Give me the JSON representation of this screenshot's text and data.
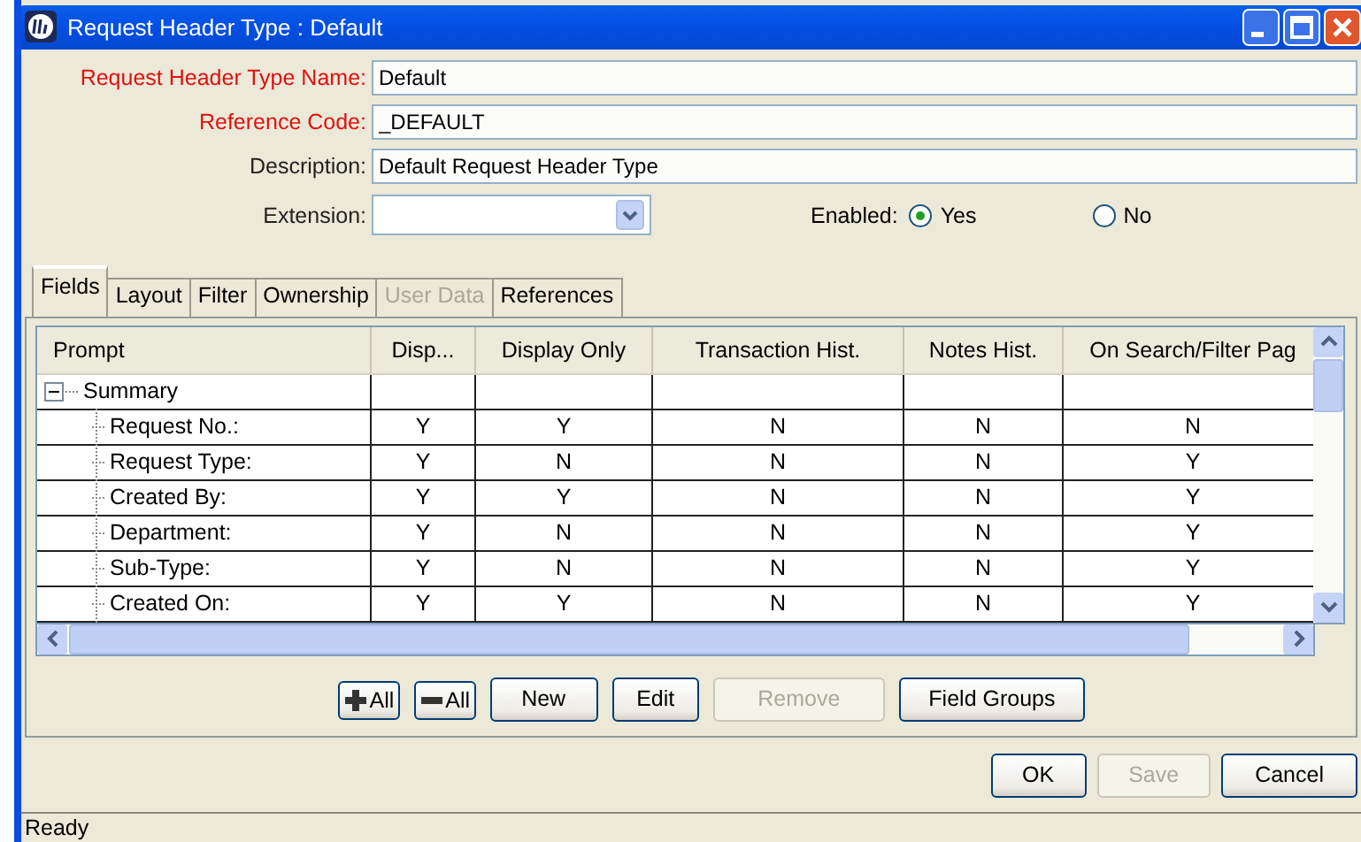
{
  "window": {
    "title": "Request Header Type : Default"
  },
  "fields": [
    {
      "kind": "text",
      "label": "Request Header Type Name:",
      "required": true,
      "value": "Default"
    },
    {
      "kind": "text",
      "label": "Reference Code:",
      "required": true,
      "value": "_DEFAULT"
    },
    {
      "kind": "text",
      "label": "Description:",
      "required": false,
      "value": "Default Request Header Type"
    }
  ],
  "extension": {
    "label": "Extension:"
  },
  "enabled": {
    "label": "Enabled:",
    "options": [
      {
        "label": "Yes",
        "selected": true
      },
      {
        "label": "No",
        "selected": false
      }
    ]
  },
  "tabs": [
    {
      "label": "Fields",
      "selected": true,
      "disabled": false
    },
    {
      "label": "Layout",
      "selected": false,
      "disabled": false
    },
    {
      "label": "Filter",
      "selected": false,
      "disabled": false
    },
    {
      "label": "Ownership",
      "selected": false,
      "disabled": false
    },
    {
      "label": "User Data",
      "selected": false,
      "disabled": true
    },
    {
      "label": "References",
      "selected": false,
      "disabled": false
    }
  ],
  "table": {
    "columns": [
      "Prompt",
      "Disp...",
      "Display Only",
      "Transaction Hist.",
      "Notes Hist.",
      "On Search/Filter Pag"
    ],
    "rows": [
      {
        "prompt": "Summary",
        "expanded": true,
        "children": [
          {
            "prompt": "Request No.:",
            "cells": [
              "Y",
              "Y",
              "N",
              "N",
              "N"
            ]
          },
          {
            "prompt": "Request Type:",
            "cells": [
              "Y",
              "N",
              "N",
              "N",
              "Y"
            ]
          },
          {
            "prompt": "Created By:",
            "cells": [
              "Y",
              "Y",
              "N",
              "N",
              "Y"
            ]
          },
          {
            "prompt": "Department:",
            "cells": [
              "Y",
              "N",
              "N",
              "N",
              "Y"
            ]
          },
          {
            "prompt": "Sub-Type:",
            "cells": [
              "Y",
              "N",
              "N",
              "N",
              "Y"
            ]
          },
          {
            "prompt": "Created On:",
            "cells": [
              "Y",
              "Y",
              "N",
              "N",
              "Y"
            ]
          }
        ]
      }
    ]
  },
  "table_buttons": [
    {
      "kind": "expand",
      "label": "All",
      "disabled": false
    },
    {
      "kind": "collapse",
      "label": "All",
      "disabled": false
    },
    {
      "kind": "text",
      "label": "New",
      "disabled": false
    },
    {
      "kind": "text",
      "label": "Edit",
      "disabled": false
    },
    {
      "kind": "text",
      "label": "Remove",
      "disabled": true
    },
    {
      "kind": "text",
      "label": "Field Groups",
      "disabled": false
    }
  ],
  "dialog_buttons": [
    {
      "label": "OK",
      "disabled": false
    },
    {
      "label": "Save",
      "disabled": true
    },
    {
      "label": "Cancel",
      "disabled": false
    }
  ],
  "status_bar": "Ready"
}
